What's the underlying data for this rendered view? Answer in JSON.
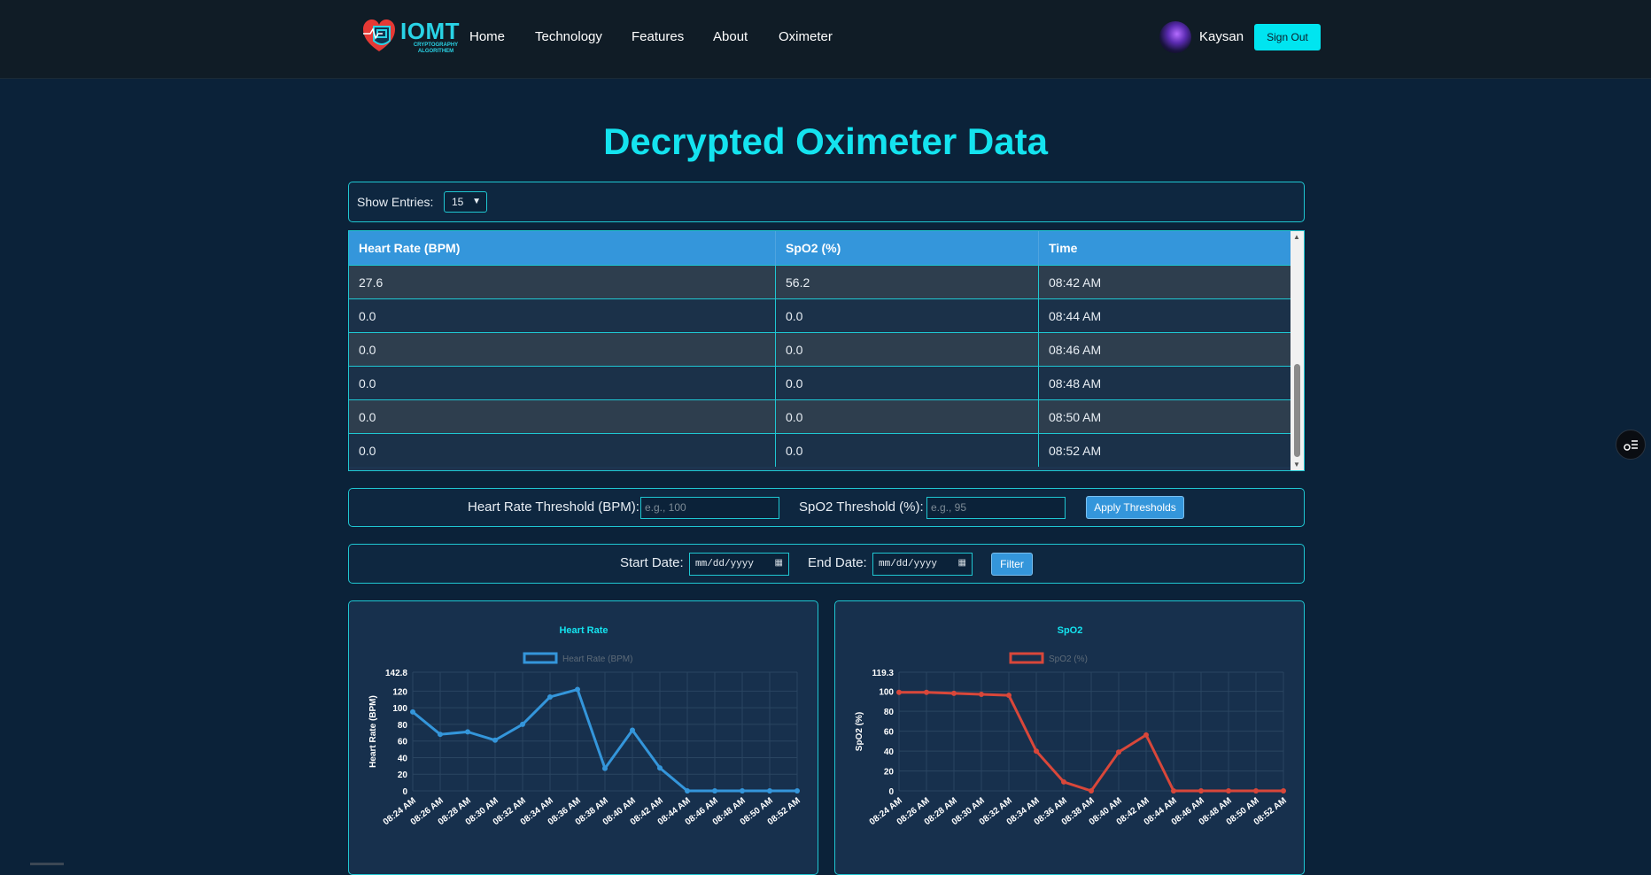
{
  "nav": {
    "logo_text": "IOMT",
    "logo_sub": "CRYPTOGRAPHY ALGORITHEM",
    "links": [
      "Home",
      "Technology",
      "Features",
      "About",
      "Oximeter"
    ],
    "username": "Kaysan",
    "signout_label": "Sign Out"
  },
  "title": "Decrypted Oximeter Data",
  "entries": {
    "label": "Show Entries:",
    "selected": "15"
  },
  "table": {
    "headers": [
      "Heart Rate (BPM)",
      "SpO2 (%)",
      "Time"
    ],
    "rows": [
      [
        "27.6",
        "56.2",
        "08:42 AM"
      ],
      [
        "0.0",
        "0.0",
        "08:44 AM"
      ],
      [
        "0.0",
        "0.0",
        "08:46 AM"
      ],
      [
        "0.0",
        "0.0",
        "08:48 AM"
      ],
      [
        "0.0",
        "0.0",
        "08:50 AM"
      ],
      [
        "0.0",
        "0.0",
        "08:52 AM"
      ]
    ]
  },
  "thresholds": {
    "hr_label": "Heart Rate Threshold (BPM):",
    "hr_placeholder": "e.g., 100",
    "spo2_label": "SpO2 Threshold (%):",
    "spo2_placeholder": "e.g., 95",
    "apply_label": "Apply Thresholds"
  },
  "dates": {
    "start_label": "Start Date:",
    "start_value": "mm/dd/yyyy",
    "end_label": "End Date:",
    "end_value": "mm/dd/yyyy",
    "filter_label": "Filter"
  },
  "colors": {
    "accent": "#14e3ef",
    "hr_line": "#3496db",
    "spo2_line": "#d9473a"
  },
  "chart_data": [
    {
      "type": "line",
      "title": "Heart Rate",
      "legend": "Heart Rate (BPM)",
      "ylabel": "Heart Rate (BPM)",
      "xlabel": "",
      "ylim": [
        0,
        142.8
      ],
      "yticks": [
        "142.8",
        "120",
        "100",
        "80",
        "60",
        "40",
        "20",
        "0"
      ],
      "x": [
        "08:24 AM",
        "08:26 AM",
        "08:28 AM",
        "08:30 AM",
        "08:32 AM",
        "08:34 AM",
        "08:36 AM",
        "08:38 AM",
        "08:40 AM",
        "08:42 AM",
        "08:44 AM",
        "08:46 AM",
        "08:48 AM",
        "08:50 AM",
        "08:52 AM"
      ],
      "values": [
        95,
        68,
        71,
        61,
        80,
        113,
        122,
        27,
        73,
        27.6,
        0,
        0,
        0,
        0,
        0
      ]
    },
    {
      "type": "line",
      "title": "SpO2",
      "legend": "SpO2 (%)",
      "ylabel": "SpO2 (%)",
      "xlabel": "",
      "ylim": [
        0,
        119.3
      ],
      "yticks": [
        "119.3",
        "100",
        "80",
        "60",
        "40",
        "20",
        "0"
      ],
      "x": [
        "08:24 AM",
        "08:26 AM",
        "08:28 AM",
        "08:30 AM",
        "08:32 AM",
        "08:34 AM",
        "08:36 AM",
        "08:38 AM",
        "08:40 AM",
        "08:42 AM",
        "08:44 AM",
        "08:46 AM",
        "08:48 AM",
        "08:50 AM",
        "08:52 AM"
      ],
      "values": [
        99,
        99,
        98,
        97,
        96,
        40,
        9,
        0,
        39,
        56.2,
        0,
        0,
        0,
        0,
        0
      ]
    }
  ]
}
